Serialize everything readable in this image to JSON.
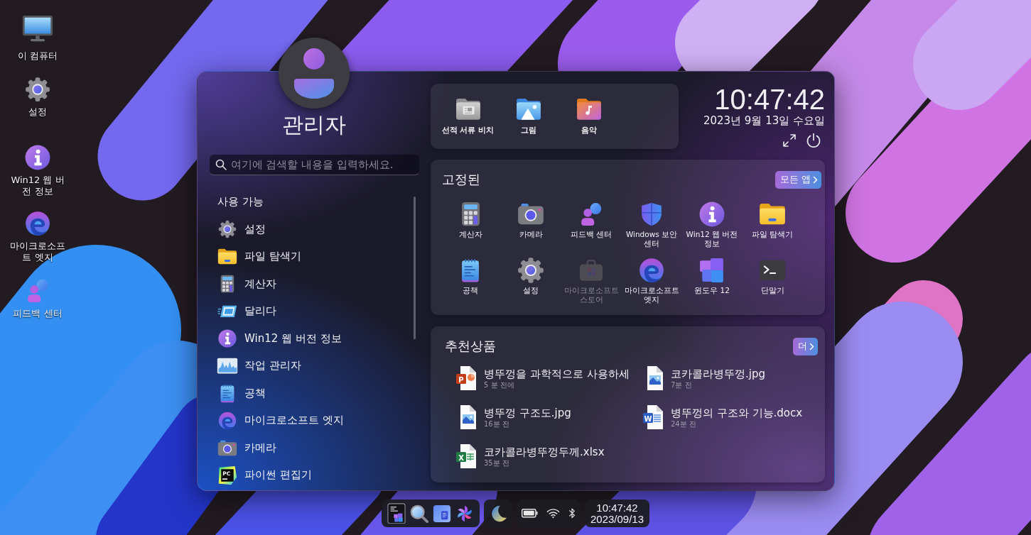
{
  "desktop": {
    "shortcuts": [
      {
        "label": "이 컴퓨터"
      },
      {
        "label": "설정"
      },
      {
        "label": "Win12 웹 버전 정보"
      },
      {
        "label": "마이크로소프트 엣지"
      },
      {
        "label": "피드백 센터"
      }
    ]
  },
  "start_menu": {
    "user": {
      "name": "관리자"
    },
    "search": {
      "placeholder": "여기에 검색할 내용을 입력하세요."
    },
    "available": {
      "title": "사용 가능",
      "items": [
        {
          "label": "설정"
        },
        {
          "label": "파일 탐색기"
        },
        {
          "label": "계산자"
        },
        {
          "label": "달리다"
        },
        {
          "label": "Win12 웹 버전 정보"
        },
        {
          "label": "작업 관리자"
        },
        {
          "label": "공책"
        },
        {
          "label": "마이크로소프트 엣지"
        },
        {
          "label": "카메라"
        },
        {
          "label": "파이썬 편집기",
          "icon_text": "PC"
        }
      ]
    },
    "quick_folders": [
      {
        "label": "선적 서류 비치"
      },
      {
        "label": "그림"
      },
      {
        "label": "음악"
      }
    ],
    "clock": {
      "time": "10:47:42",
      "date": "2023년 9월 13일 수요일"
    },
    "pinned": {
      "title": "고정된",
      "button": "모든 앱",
      "apps": [
        {
          "label": "계산자",
          "disabled": false
        },
        {
          "label": "카메라",
          "disabled": false
        },
        {
          "label": "피드백 센터",
          "disabled": false
        },
        {
          "label": "Windows 보안 센터",
          "disabled": false
        },
        {
          "label": "Win12 웹 버전 정보",
          "disabled": false
        },
        {
          "label": "파일 탐색기",
          "disabled": false
        },
        {
          "label": "공책",
          "disabled": false
        },
        {
          "label": "설정",
          "disabled": false
        },
        {
          "label": "마이크로소프트 스토어",
          "disabled": true
        },
        {
          "label": "마이크로소프트 엣지",
          "disabled": false
        },
        {
          "label": "윈도우 12",
          "disabled": false
        },
        {
          "label": "단말기",
          "disabled": false
        }
      ]
    },
    "recommended": {
      "title": "추천상품",
      "button": "더",
      "files": [
        {
          "name": "병뚜껑을 과학적으로 사용하세",
          "time": "5 분 전에",
          "icon_text": "P"
        },
        {
          "name": "코카콜라병뚜껑.jpg",
          "time": "7분 전"
        },
        {
          "name": "병뚜껑 구조도.jpg",
          "time": "16분 전"
        },
        {
          "name": "병뚜껑의 구조와 기능.docx",
          "time": "24분 전",
          "icon_text": "W"
        },
        {
          "name": "코카콜라병뚜껑두께.xlsx",
          "time": "35분 전",
          "icon_text": "X"
        }
      ]
    }
  },
  "taskbar": {
    "clock": {
      "time": "10:47:42",
      "date": "2023/09/13"
    }
  }
}
